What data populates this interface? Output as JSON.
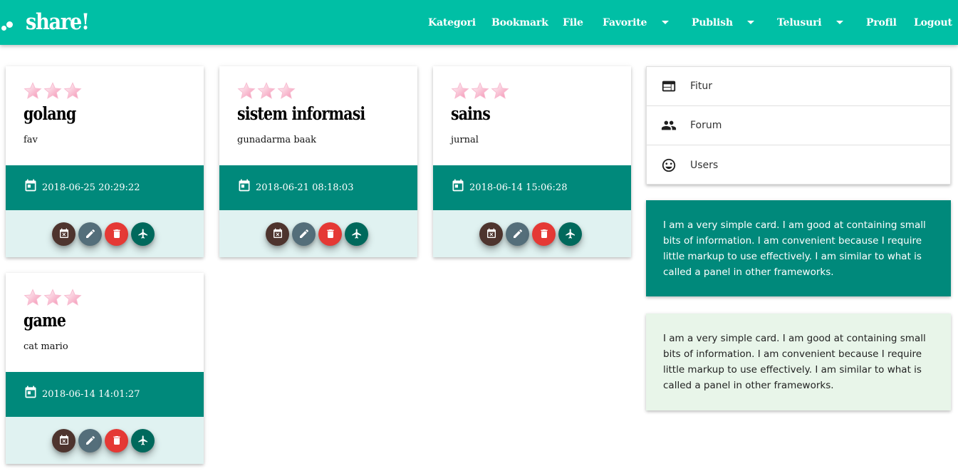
{
  "navbar": {
    "brand": "share!",
    "items": [
      {
        "label": "Kategori",
        "dropdown": false
      },
      {
        "label": "Bookmark",
        "dropdown": false
      },
      {
        "label": "File",
        "dropdown": false
      },
      {
        "label": "Favorite",
        "dropdown": true
      },
      {
        "label": "Publish",
        "dropdown": true
      },
      {
        "label": "Telusuri",
        "dropdown": true
      },
      {
        "label": "Profil",
        "dropdown": false
      },
      {
        "label": "Logout",
        "dropdown": false
      }
    ]
  },
  "cards": [
    {
      "stars": 3,
      "title": "golang",
      "subtitle": "fav",
      "date": "2018-06-25 20:29:22"
    },
    {
      "stars": 3,
      "title": "sistem informasi",
      "subtitle": "gunadarma baak",
      "date": "2018-06-21 08:18:03"
    },
    {
      "stars": 3,
      "title": "sains",
      "subtitle": "jurnal",
      "date": "2018-06-14 15:06:28"
    },
    {
      "stars": 3,
      "title": "game",
      "subtitle": "cat mario",
      "date": "2018-06-14 14:01:27"
    }
  ],
  "card_actions": [
    {
      "icon": "calendar-remove-icon",
      "color": "#4e342e"
    },
    {
      "icon": "pencil-icon",
      "color": "#546e7a"
    },
    {
      "icon": "trash-icon",
      "color": "#e53935"
    },
    {
      "icon": "airplane-icon",
      "color": "#00695c"
    }
  ],
  "sidebar": {
    "items": [
      {
        "label": "Fitur",
        "icon": "web-icon"
      },
      {
        "label": "Forum",
        "icon": "people-icon"
      },
      {
        "label": "Users",
        "icon": "smiley-icon"
      }
    ]
  },
  "panels": {
    "teal_text": "I am a very simple card. I am good at containing small bits of information. I am convenient because I require little markup to use effectively. I am similar to what is called a panel in other frameworks.",
    "light_text": "I am a very simple card. I am good at containing small bits of information. I am convenient because I require little markup to use effectively. I am similar to what is called a panel in other frameworks."
  },
  "colors": {
    "navbar": "#00bfa5",
    "date_band": "#00897b",
    "actions_bg": "#e0f2f1",
    "light_panel": "#e8f5e9",
    "star": "#f48fb1"
  }
}
